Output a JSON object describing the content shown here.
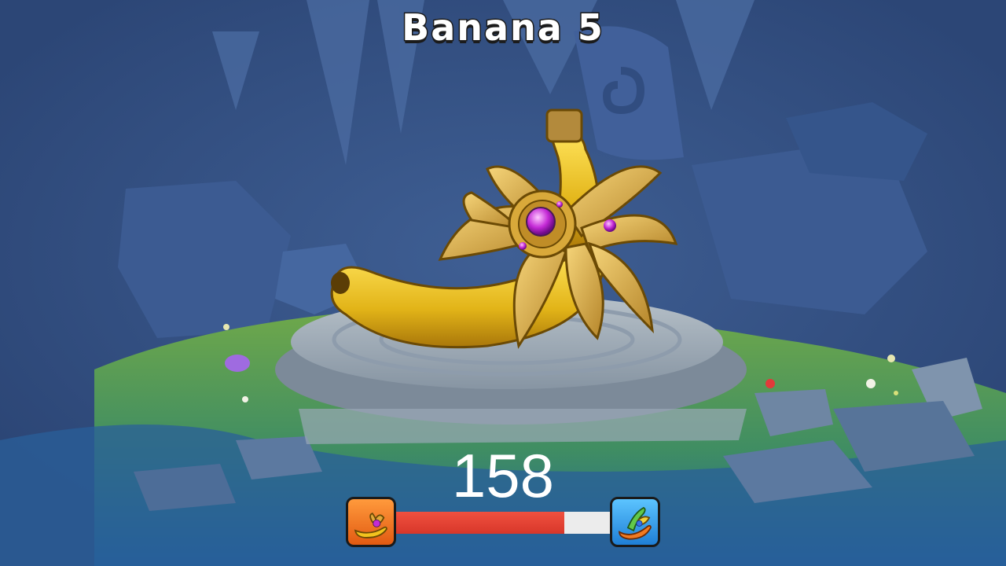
{
  "item": {
    "title": "Banana 5",
    "count": "158"
  },
  "progress": {
    "fraction": 0.78,
    "current_icon": "golden-banana-icon",
    "next_icon": "rainbow-banana-icon"
  },
  "colors": {
    "background": "#33507f",
    "progress_fill": "#e8412f",
    "progress_track": "#ececec",
    "left_badge": "#f07a22",
    "right_badge": "#3aa2ee"
  }
}
